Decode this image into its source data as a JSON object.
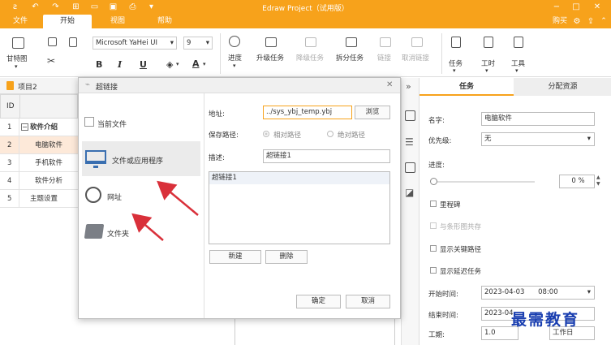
{
  "app": {
    "title": "Edraw Project（试用版）",
    "buy": "购买"
  },
  "menu": [
    "文件",
    "开始",
    "视图",
    "帮助"
  ],
  "menu_active": 1,
  "ribbon": {
    "gantt": "甘特图",
    "font": "Microsoft YaHei UI",
    "size": "9",
    "progress": "进度",
    "indent": "升级任务",
    "outdent": "降级任务",
    "split": "拆分任务",
    "link": "链接",
    "unlink": "取消链接",
    "task": "任务",
    "worktime": "工时",
    "tools": "工具",
    "bold": "B",
    "italic": "I",
    "underline": "U",
    "fontcolor": "A"
  },
  "project": {
    "tab": "项目2"
  },
  "table": {
    "header": "ID",
    "rows": [
      {
        "id": "1",
        "name": "软件介绍"
      },
      {
        "id": "2",
        "name": "电脑软件"
      },
      {
        "id": "3",
        "name": "手机软件"
      },
      {
        "id": "4",
        "name": "软件分析"
      },
      {
        "id": "5",
        "name": "主题设置"
      }
    ],
    "collapse": "−"
  },
  "dialog": {
    "title": "超链接",
    "options": [
      "当前文件",
      "文件或应用程序",
      "网址",
      "文件夹"
    ],
    "selected": 1,
    "address_label": "地址:",
    "address_value": "../sys_ybj_temp.ybj",
    "browse": "浏览",
    "save_path_label": "保存路径:",
    "relative": "相对路径",
    "absolute": "绝对路径",
    "desc_label": "描述:",
    "desc_value": "超链接1",
    "list_items": [
      "超链接1"
    ],
    "new": "新建",
    "delete": "删除",
    "ok": "确定",
    "cancel": "取消"
  },
  "right": {
    "tabs": [
      "任务",
      "分配资源"
    ],
    "name_label": "名字:",
    "name_value": "电脑软件",
    "priority_label": "优先级:",
    "priority_value": "无",
    "progress_label": "进度:",
    "progress_value": "0",
    "progress_unit": "%",
    "progress_fraction": 0,
    "milestone": "里程碑",
    "coexist": "与条形图共存",
    "critical": "显示关键路径",
    "delay": "显示延迟任务",
    "start_label": "开始时间:",
    "start_date": "2023-04-03",
    "start_time": "08:00",
    "end_label": "结束时间:",
    "end_date": "2023-04-",
    "duration_label": "工期:",
    "duration_value": "1.0",
    "duration_unit": "工作日"
  },
  "watermark": "最需教育",
  "colors": {
    "accent": "#F7A21B",
    "arrow": "#D9303A"
  }
}
